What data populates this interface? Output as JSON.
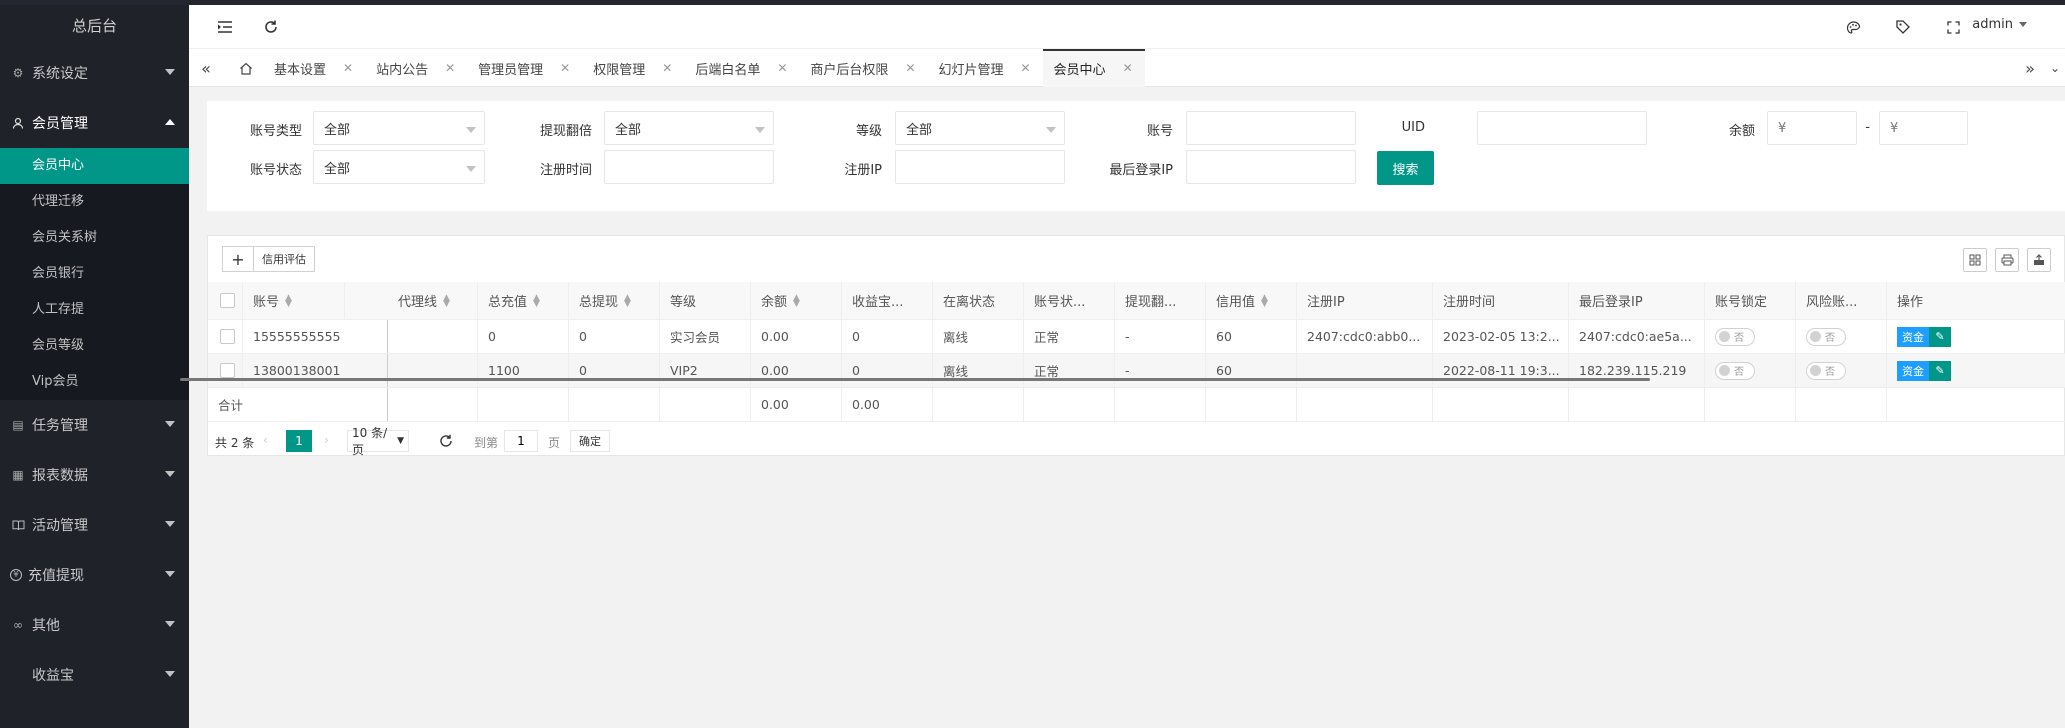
{
  "sidebar": {
    "logo": "总后台",
    "menus": [
      {
        "label": "系统设定",
        "icon": "gear-icon",
        "glyph": "⚙"
      },
      {
        "label": "会员管理",
        "icon": "user-icon",
        "glyph": "👤"
      },
      {
        "label": "任务管理",
        "icon": "task-icon",
        "glyph": "▤"
      },
      {
        "label": "报表数据",
        "icon": "report-icon",
        "glyph": "▦"
      },
      {
        "label": "活动管理",
        "icon": "book-icon",
        "glyph": "📖"
      },
      {
        "label": "充值提现",
        "icon": "yen-icon",
        "glyph": "¥"
      },
      {
        "label": "其他",
        "icon": "link-icon",
        "glyph": "∞"
      },
      {
        "label": "收益宝",
        "icon": "",
        "glyph": ""
      }
    ],
    "submenu": [
      "会员中心",
      "代理迁移",
      "会员关系树",
      "会员银行",
      "人工存提",
      "会员等级",
      "Vip会员"
    ]
  },
  "header": {
    "user": "admin"
  },
  "tabs": [
    "基本设置",
    "站内公告",
    "管理员管理",
    "权限管理",
    "后端白名单",
    "商户后台权限",
    "幻灯片管理",
    "会员中心"
  ],
  "search": {
    "account_type_label": "账号类型",
    "account_type_value": "全部",
    "withdraw_label": "提现翻倍",
    "withdraw_value": "全部",
    "level_label": "等级",
    "level_value": "全部",
    "account_label": "账号",
    "uid_label": "UID",
    "balance_label": "余额",
    "balance_min_placeholder": "¥",
    "balance_sep": "-",
    "balance_max_placeholder": "¥",
    "status_label": "账号状态",
    "status_value": "全部",
    "regtime_label": "注册时间",
    "regip_label": "注册IP",
    "lastip_label": "最后登录IP",
    "search_button": "搜索"
  },
  "toolbar": {
    "add": "+",
    "credit": "信用评估"
  },
  "table": {
    "columns": [
      "账号",
      "代理线",
      "总充值",
      "总提现",
      "等级",
      "余额",
      "收益宝...",
      "在离状态",
      "账号状...",
      "提现翻...",
      "信用值",
      "注册IP",
      "注册时间",
      "最后登录IP",
      "账号锁定",
      "风险账...",
      "操作"
    ],
    "rows": [
      [
        "15555555555",
        "",
        "0",
        "0",
        "实习会员",
        "0.00",
        "0",
        "离线",
        "正常",
        "-",
        "60",
        "2407:cdc0:abb0...",
        "2023-02-05 13:2...",
        "2407:cdc0:ae5a...",
        "否",
        "否"
      ],
      [
        "13800138001",
        "",
        "1100",
        "0",
        "VIP2",
        "0.00",
        "0",
        "离线",
        "正常",
        "-",
        "60",
        "",
        "2022-08-11 19:3...",
        "182.239.115.219",
        "否",
        "否"
      ]
    ],
    "total_label": "合计",
    "total_balance": "0.00",
    "total_yield": "0.00",
    "op_fund": "资金"
  },
  "pager": {
    "total": "共 2 条",
    "current": "1",
    "size": "10 条/页",
    "goto_label": "到第",
    "goto_value": "1",
    "page_unit": "页",
    "confirm": "确定"
  }
}
